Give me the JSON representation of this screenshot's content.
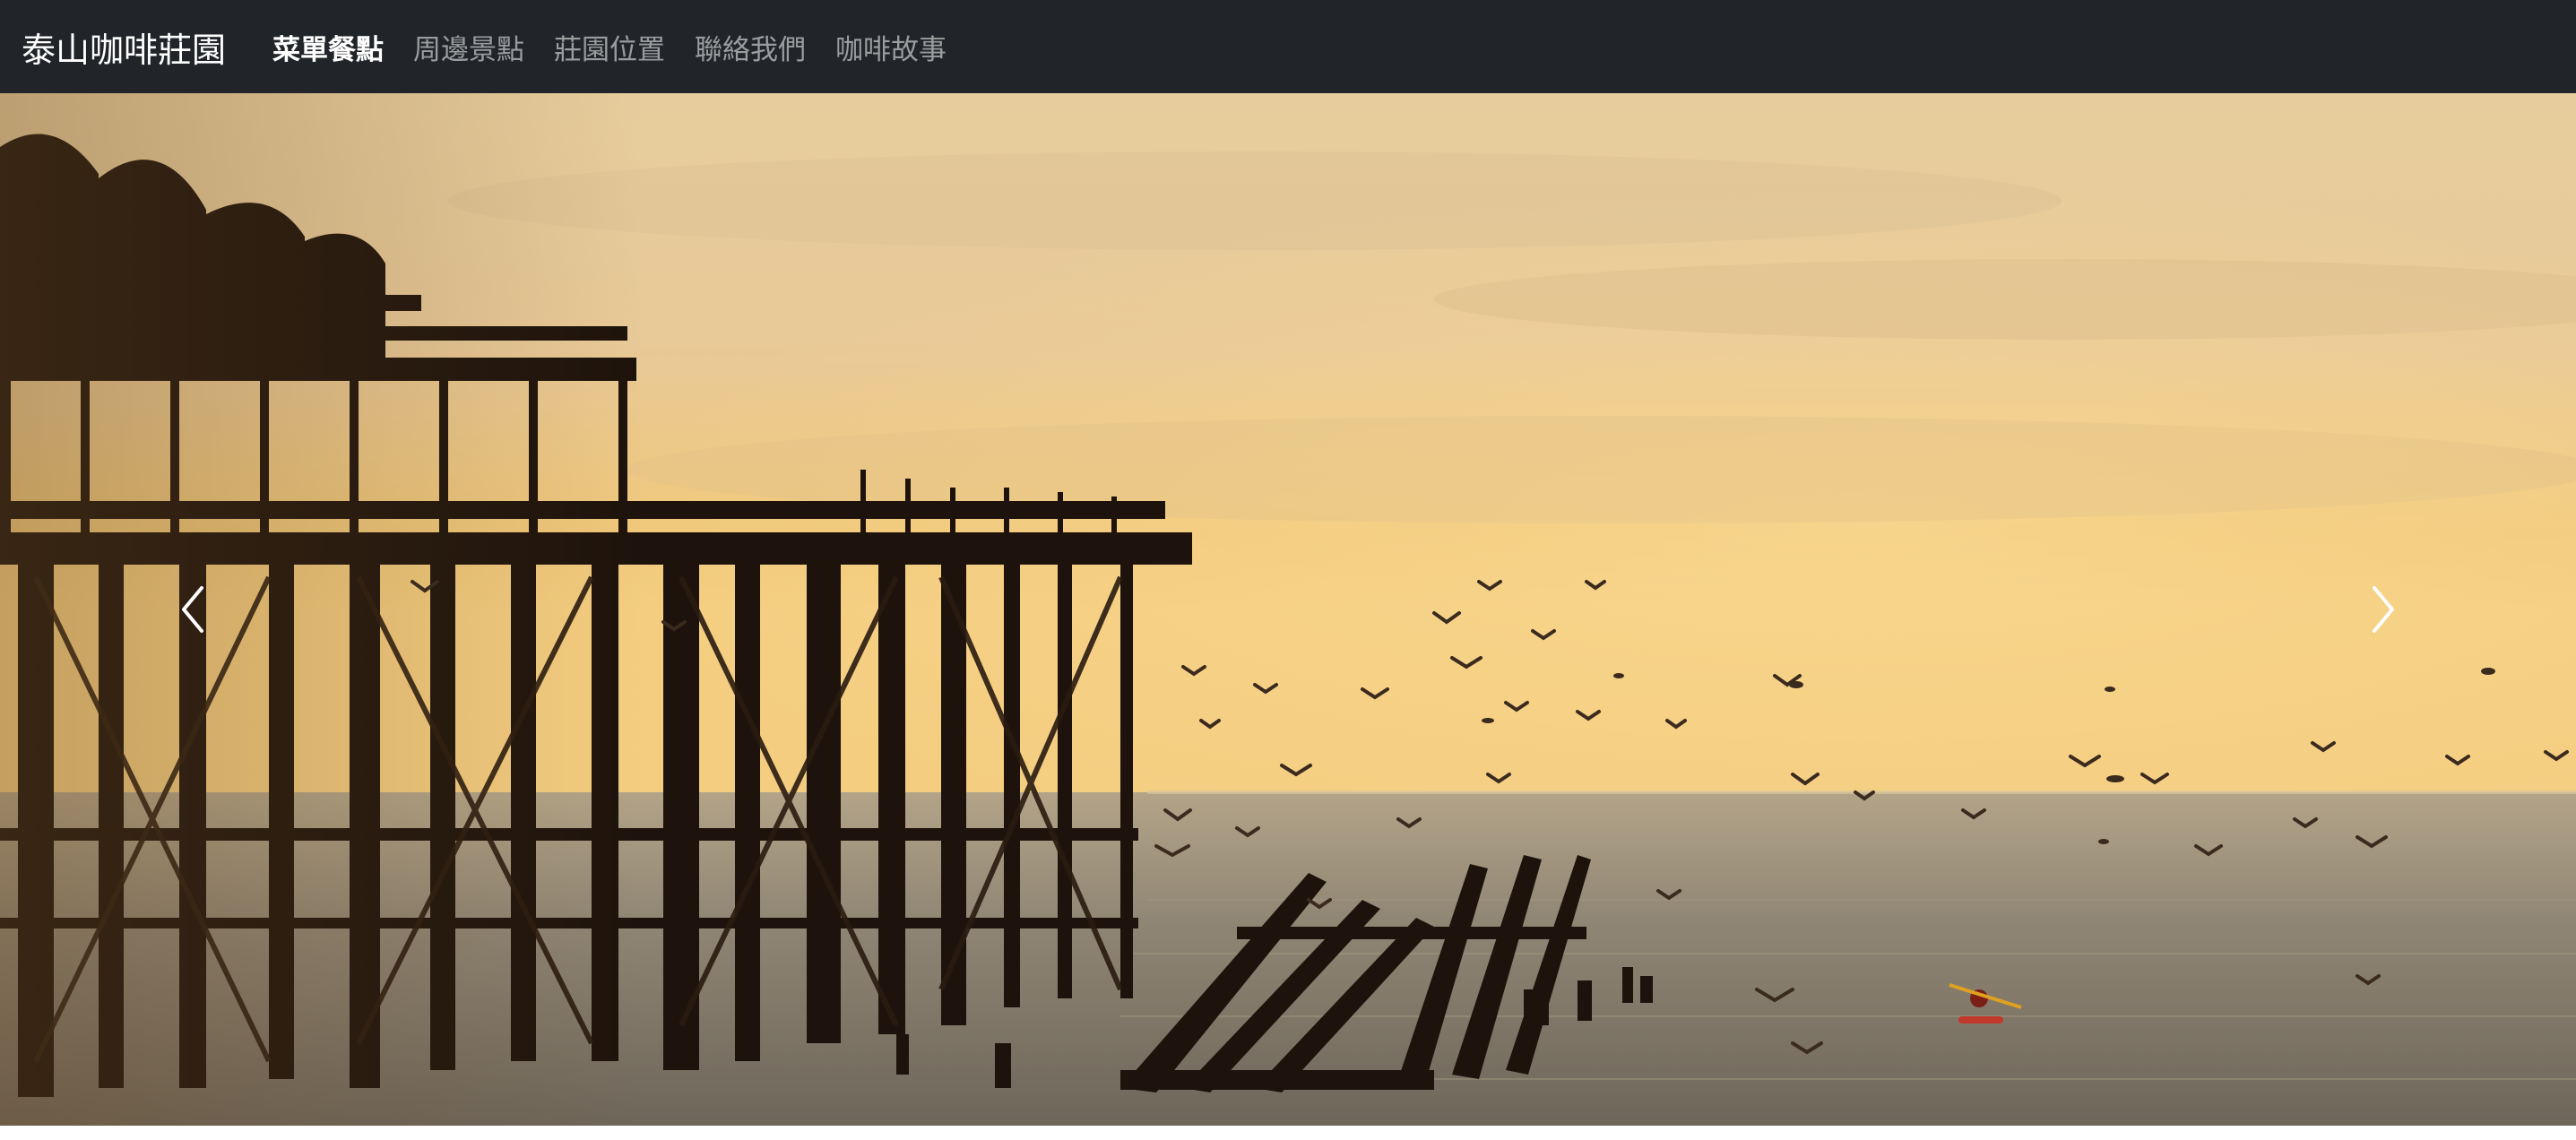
{
  "navbar": {
    "brand": "泰山咖啡莊園",
    "links": [
      {
        "label": "菜單餐點",
        "active": true
      },
      {
        "label": "周邊景點",
        "active": false
      },
      {
        "label": "莊園位置",
        "active": false
      },
      {
        "label": "聯絡我們",
        "active": false
      },
      {
        "label": "咖啡故事",
        "active": false
      }
    ]
  },
  "carousel": {
    "slide_image": "sunset-pier-with-seagulls",
    "prev_icon": "chevron-left-icon",
    "next_icon": "chevron-right-icon"
  },
  "colors": {
    "navbar_bg": "#212529",
    "sky_top": "#e9cfa1",
    "sky_horizon": "#f2c877",
    "sea": "#8f8574",
    "pier": "#1e130c"
  }
}
